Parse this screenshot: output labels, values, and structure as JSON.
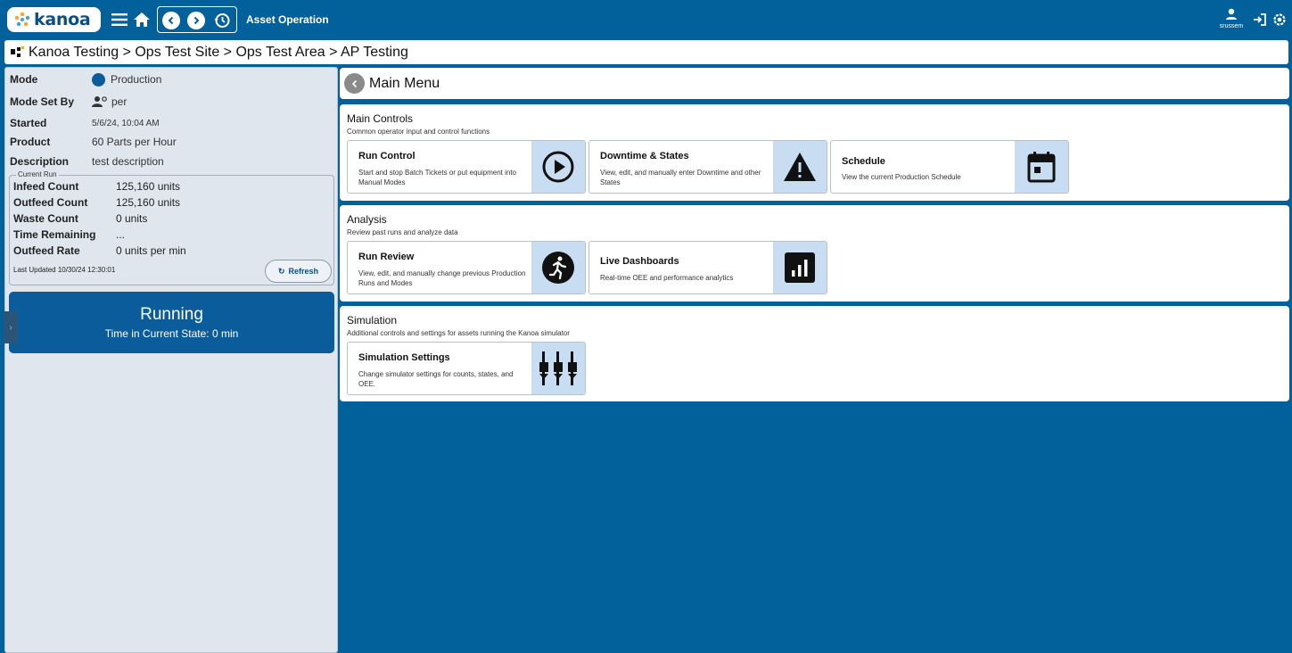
{
  "topbar": {
    "logo_text": "kanoa",
    "app_title": "Asset Operation",
    "username": "srussem"
  },
  "breadcrumb": "Kanoa Testing > Ops Test Site > Ops Test Area > AP Testing",
  "left_panel": {
    "mode_label": "Mode",
    "mode_value": "Production",
    "mode_set_by_label": "Mode Set By",
    "mode_set_by_value": "per",
    "started_label": "Started",
    "started_value": "5/6/24, 10:04 AM",
    "product_label": "Product",
    "product_value": "60 Parts per Hour",
    "description_label": "Description",
    "description_value": "test description",
    "current_run": {
      "legend": "Current Run",
      "infeed_label": "Infeed Count",
      "infeed_value": "125,160 units",
      "outfeed_label": "Outfeed Count",
      "outfeed_value": "125,160 units",
      "waste_label": "Waste Count",
      "waste_value": "0 units",
      "time_remaining_label": "Time Remaining",
      "time_remaining_value": "...",
      "outfeed_rate_label": "Outfeed Rate",
      "outfeed_rate_value": "0 units per min",
      "last_updated": "Last Updated 10/30/24 12:30:01",
      "refresh_label": "Refresh"
    },
    "state": {
      "title": "Running",
      "subtitle": "Time in Current State: 0 min"
    }
  },
  "main_menu": {
    "title": "Main Menu",
    "sections": [
      {
        "title": "Main Controls",
        "subtitle": "Common operator input and control functions",
        "cards": [
          {
            "title": "Run Control",
            "desc": "Start and stop Batch Tickets or put equipment into Manual Modes",
            "icon": "play-circle-icon"
          },
          {
            "title": "Downtime & States",
            "desc": "View, edit, and manually enter Downtime and other States",
            "icon": "warning-icon"
          },
          {
            "title": "Schedule",
            "desc": "View the current Production Schedule",
            "icon": "calendar-icon"
          }
        ]
      },
      {
        "title": "Analysis",
        "subtitle": "Review past runs and analyze data",
        "cards": [
          {
            "title": "Run Review",
            "desc": "View, edit, and manually change previous Production Runs and Modes",
            "icon": "running-person-icon"
          },
          {
            "title": "Live Dashboards",
            "desc": "Real-time OEE and performance analytics",
            "icon": "bar-chart-icon"
          }
        ]
      },
      {
        "title": "Simulation",
        "subtitle": "Additional controls and settings for assets running the Kanoa simulator",
        "cards": [
          {
            "title": "Simulation Settings",
            "desc": "Change simulator settings for counts, states, and OEE.",
            "icon": "equalizer-icon"
          }
        ]
      }
    ]
  }
}
